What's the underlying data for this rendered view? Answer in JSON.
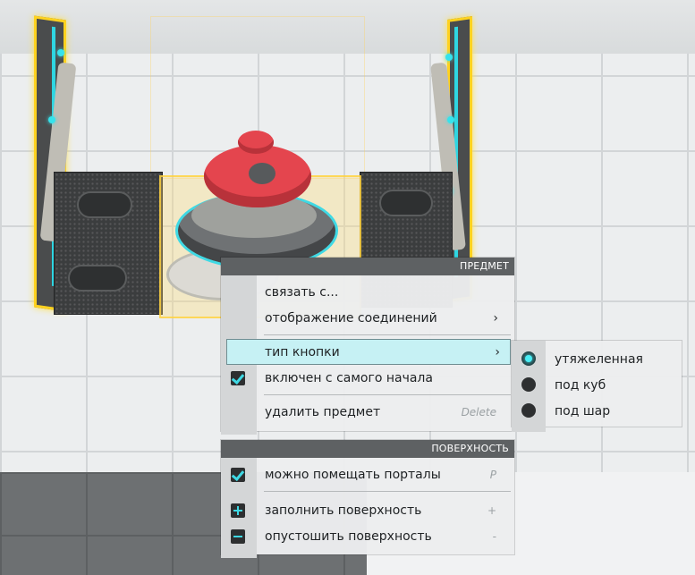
{
  "item_menu": {
    "header": "ПРЕДМЕТ",
    "items": [
      {
        "label": "связать с...",
        "shortcut": "",
        "submenu": false,
        "icon": "",
        "checked": false
      },
      {
        "label": "отображение соединений",
        "shortcut": "",
        "submenu": true,
        "icon": "",
        "checked": false
      },
      {
        "label": "тип кнопки",
        "shortcut": "",
        "submenu": true,
        "icon": "",
        "highlighted": true
      },
      {
        "label": "включен с самого начала",
        "shortcut": "",
        "submenu": false,
        "icon": "checkbox-checked-icon",
        "checked": true
      },
      {
        "label": "удалить предмет",
        "shortcut": "Delete",
        "submenu": false,
        "icon": ""
      }
    ],
    "chevron": "›"
  },
  "button_type_submenu": {
    "options": [
      {
        "label": "утяжеленная",
        "selected": true
      },
      {
        "label": "под куб",
        "selected": false
      },
      {
        "label": "под шар",
        "selected": false
      }
    ]
  },
  "surface_menu": {
    "header": "ПОВЕРХНОСТЬ",
    "items": [
      {
        "label": "можно помещать порталы",
        "shortcut": "P",
        "icon": "checkbox-checked-icon",
        "checked": true
      },
      {
        "label": "заполнить поверхность",
        "shortcut": "+",
        "icon": "plus-icon"
      },
      {
        "label": "опустошить поверхность",
        "shortcut": "-",
        "icon": "minus-icon"
      }
    ]
  },
  "colors": {
    "accent": "#3fd9e4",
    "highlight": "#c6f1f4",
    "header": "#5e6163",
    "selection": "#ffd21f",
    "button_red": "#e4454e"
  }
}
